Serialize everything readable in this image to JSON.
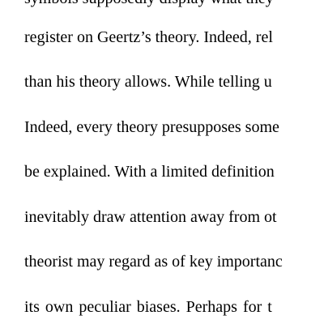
{
  "document": {
    "lines": [
      "symbols supposedly display what they",
      "register on Geertz’s theory. Indeed, rel",
      "than his theory allows. While telling u",
      "Indeed, every theory presupposes some",
      "be explained. With a limited definition",
      "inevitably draw attention away from ot",
      "theorist may regard as of key importanc",
      "its own peculiar biases. Perhaps for t"
    ]
  }
}
